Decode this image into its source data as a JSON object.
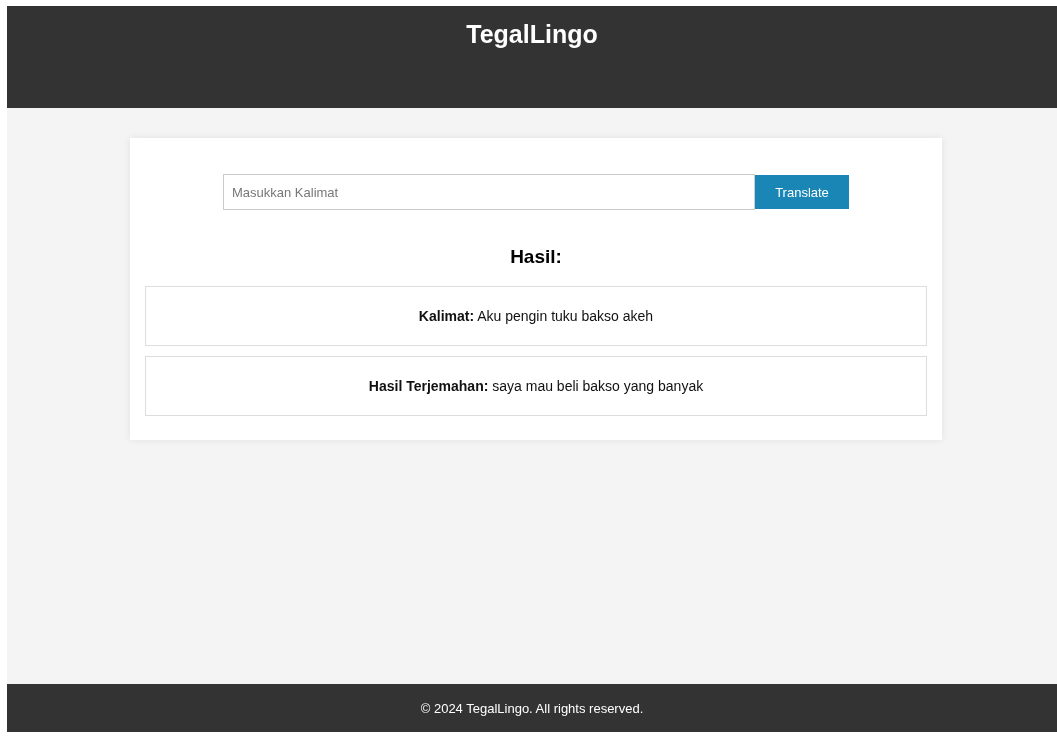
{
  "header": {
    "title": "TegalLingo"
  },
  "form": {
    "placeholder": "Masukkan Kalimat",
    "button": "Translate"
  },
  "result": {
    "heading": "Hasil:",
    "items": [
      {
        "text": "**Kalimat:** Aku pengin tuku bakso akeh"
      },
      {
        "text": "**Hasil Terjemahan:** saya mau beli bakso yang banyak"
      }
    ]
  },
  "footer": {
    "text": "© 2024 TegalLingo. All rights reserved."
  }
}
